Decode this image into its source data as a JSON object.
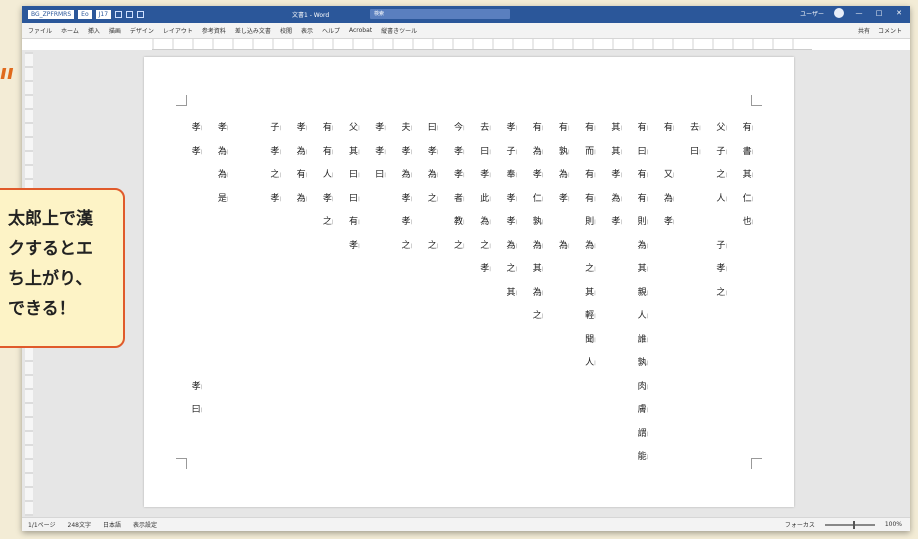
{
  "background_text": "ıı",
  "window": {
    "quick_access": [
      "BG_ZPFRMRS",
      "Eo",
      "J17"
    ],
    "title": "文書1 - Word",
    "search_placeholder": "検索",
    "user": "ユーザー",
    "window_buttons": [
      "—",
      "□",
      "✕"
    ]
  },
  "ribbon": {
    "tabs": [
      "ファイル",
      "ホーム",
      "挿入",
      "描画",
      "デザイン",
      "レイアウト",
      "参考資料",
      "差し込み文書",
      "校閲",
      "表示",
      "ヘルプ",
      "Acrobat",
      "縦書きツール"
    ],
    "right": [
      "共有",
      "コメント"
    ]
  },
  "document": {
    "columns": [
      [
        "有",
        "書",
        "其",
        "仁",
        "也"
      ],
      [
        "父",
        "子",
        "之",
        "人",
        "",
        "子",
        "孝",
        "之"
      ],
      [
        "去",
        "曰",
        "",
        "",
        ""
      ],
      [
        "有",
        "",
        "又",
        "為",
        "孝"
      ],
      [
        "有",
        "曰",
        "有",
        "有",
        "則",
        "為",
        "其",
        "親",
        "人",
        "誰",
        "孰",
        "肉",
        "膚",
        "謂",
        "能"
      ],
      [
        "其",
        "其",
        "孝",
        "為",
        "孝"
      ],
      [
        "有",
        "而",
        "有",
        "有",
        "則",
        "為",
        "之",
        "其",
        "輕",
        "聞",
        "人"
      ],
      [
        "有",
        "孰",
        "為",
        "孝",
        "",
        "為"
      ],
      [
        "有",
        "為",
        "孝",
        "仁",
        "孰",
        "為",
        "其",
        "為",
        "之"
      ],
      [
        "孝",
        "子",
        "奉",
        "孝",
        "孝",
        "為",
        "之",
        "其"
      ],
      [
        "去",
        "曰",
        "孝",
        "此",
        "為",
        "之",
        "孝"
      ],
      [
        "今",
        "孝",
        "孝",
        "者",
        "教",
        "之"
      ],
      [
        "曰",
        "孝",
        "為",
        "之",
        "",
        "之"
      ],
      [
        "夫",
        "孝",
        "為",
        "孝",
        "孝",
        "之"
      ],
      [
        "孝",
        "孝",
        "曰"
      ],
      [
        "父",
        "其",
        "曰",
        "曰",
        "有",
        "孝"
      ],
      [
        "有",
        "有",
        "人",
        "孝",
        "之"
      ],
      [
        "孝",
        "為",
        "有",
        "為"
      ],
      [
        "子",
        "孝",
        "之",
        "孝"
      ],
      [
        "",
        ""
      ],
      [
        "孝",
        "為",
        "為",
        "是"
      ],
      [
        "孝",
        "孝",
        "",
        "",
        "",
        "",
        "",
        "",
        "",
        "",
        "",
        "孝",
        "曰"
      ]
    ]
  },
  "status": {
    "left": [
      "1/1ページ",
      "248文字",
      "日本語",
      "表示設定"
    ],
    "right": [
      "フォーカス",
      "100%"
    ]
  },
  "callout": {
    "lines": [
      "太郎上で漢",
      "クするとエ",
      "ち上がり、",
      "できる！"
    ]
  },
  "colors": {
    "titlebar": "#2b579a",
    "callout_border": "#e05a2b",
    "callout_bg": "#fdf3c6"
  }
}
